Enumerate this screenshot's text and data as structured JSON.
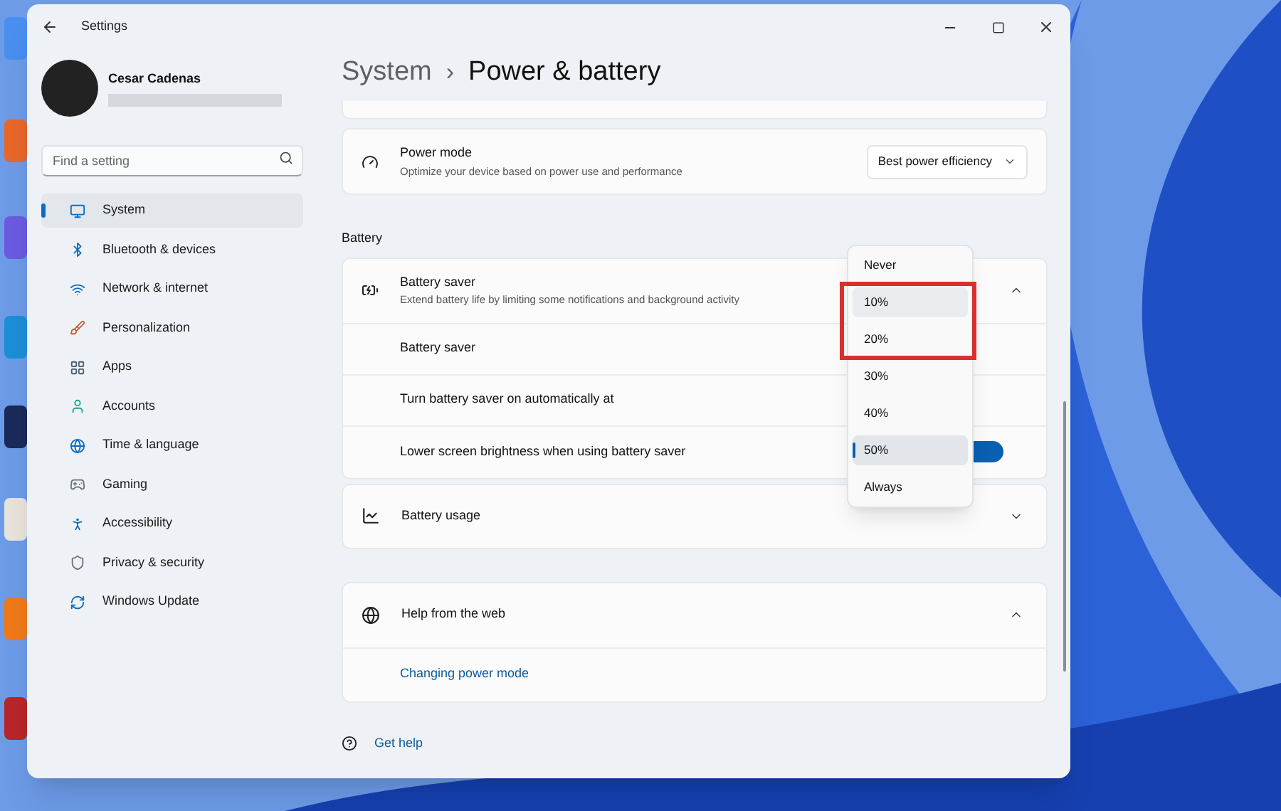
{
  "window": {
    "title": "Settings"
  },
  "account": {
    "name": "Cesar Cadenas"
  },
  "search": {
    "placeholder": "Find a setting"
  },
  "sidebar": {
    "items": [
      {
        "label": "System",
        "selected": true
      },
      {
        "label": "Bluetooth & devices",
        "selected": false
      },
      {
        "label": "Network & internet",
        "selected": false
      },
      {
        "label": "Personalization",
        "selected": false
      },
      {
        "label": "Apps",
        "selected": false
      },
      {
        "label": "Accounts",
        "selected": false
      },
      {
        "label": "Time & language",
        "selected": false
      },
      {
        "label": "Gaming",
        "selected": false
      },
      {
        "label": "Accessibility",
        "selected": false
      },
      {
        "label": "Privacy & security",
        "selected": false
      },
      {
        "label": "Windows Update",
        "selected": false
      }
    ]
  },
  "breadcrumb": {
    "parent": "System",
    "separator": "›",
    "current": "Power & battery"
  },
  "power_mode": {
    "title": "Power mode",
    "description": "Optimize your device based on power use and performance",
    "value": "Best power efficiency"
  },
  "battery_section": {
    "heading": "Battery",
    "battery_saver": {
      "title": "Battery saver",
      "description": "Extend battery life by limiting some notifications and background activity",
      "expanded": true,
      "rows": [
        {
          "label": "Battery saver"
        },
        {
          "label": "Turn battery saver on automatically at"
        },
        {
          "label": "Lower screen brightness when using battery saver",
          "on": true
        }
      ]
    },
    "battery_usage": {
      "title": "Battery usage",
      "expanded": false
    }
  },
  "help": {
    "title": "Help from the web",
    "expanded": true,
    "links": [
      "Changing power mode"
    ]
  },
  "footer": {
    "links": [
      "Get help"
    ]
  },
  "dropdown": {
    "options": [
      {
        "label": "Never",
        "selected": false,
        "hovered": false
      },
      {
        "label": "10%",
        "selected": false,
        "hovered": true
      },
      {
        "label": "20%",
        "selected": false,
        "hovered": false
      },
      {
        "label": "30%",
        "selected": false,
        "hovered": false
      },
      {
        "label": "40%",
        "selected": false,
        "hovered": false
      },
      {
        "label": "50%",
        "selected": true,
        "hovered": false
      },
      {
        "label": "Always",
        "selected": false,
        "hovered": false
      }
    ]
  }
}
